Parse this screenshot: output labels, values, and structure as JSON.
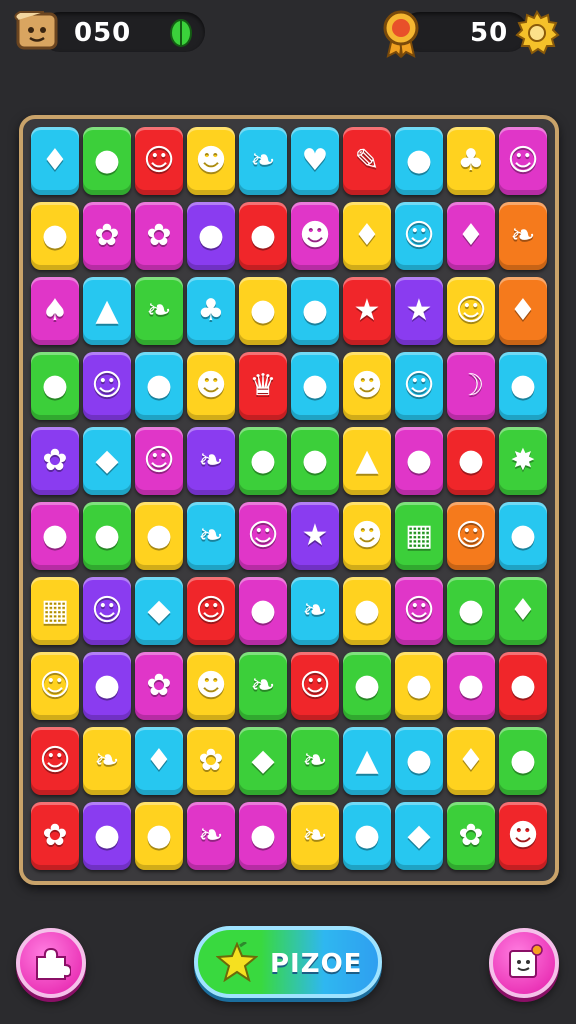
{
  "hud": {
    "left_value": "050",
    "right_value": "50",
    "left_icon": "scroll-face-icon",
    "left_gem_icon": "green-leaf-gem-icon",
    "right_medal_icon": "orange-medal-icon",
    "right_settings_icon": "gear-icon"
  },
  "buttons": {
    "left_icon": "puzzle-piece-icon",
    "main_label": "PIZOE",
    "main_icon": "star-fruit-icon",
    "right_icon": "smiling-cube-icon"
  },
  "colors": {
    "background": "#2b2b2e",
    "frame": "#c9a36a",
    "main_button_green": "#39d93f",
    "main_button_blue": "#2fb7f0",
    "round_button_pink": "#e31aa8"
  },
  "board": {
    "rows": [
      [
        {
          "color": "#27c7f0",
          "icon": "yellow-lemon-icon",
          "glyph": "♦"
        },
        {
          "color": "#3ccf3a",
          "icon": "yellow-lemon-icon",
          "glyph": "●"
        },
        {
          "color": "#f0262a",
          "icon": "white-ghost-face-icon",
          "glyph": "☺"
        },
        {
          "color": "#ffd21f",
          "icon": "yellow-face-icon",
          "glyph": "☻"
        },
        {
          "color": "#27c7f0",
          "icon": "orange-leaf-icon",
          "glyph": "❧"
        },
        {
          "color": "#27c7f0",
          "icon": "red-heart-icon",
          "glyph": "♥"
        },
        {
          "color": "#f0262a",
          "icon": "pink-candy-icon",
          "glyph": "✎"
        },
        {
          "color": "#27c7f0",
          "icon": "red-apple-icon",
          "glyph": "●"
        },
        {
          "color": "#ffd21f",
          "icon": "green-broccoli-icon",
          "glyph": "♣"
        },
        {
          "color": "#e036c8",
          "icon": "yellow-face-icon",
          "glyph": "☺"
        }
      ],
      [
        {
          "color": "#ffd21f",
          "icon": "green-apple-icon",
          "glyph": "●"
        },
        {
          "color": "#e036c8",
          "icon": "orange-flower-icon",
          "glyph": "✿"
        },
        {
          "color": "#e036c8",
          "icon": "green-flower-icon",
          "glyph": "✿"
        },
        {
          "color": "#8a3cf0",
          "icon": "blue-apple-icon",
          "glyph": "●"
        },
        {
          "color": "#f0262a",
          "icon": "yellow-ball-icon",
          "glyph": "●"
        },
        {
          "color": "#e036c8",
          "icon": "red-tomato-face-icon",
          "glyph": "☻"
        },
        {
          "color": "#ffd21f",
          "icon": "blue-drop-icon",
          "glyph": "♦"
        },
        {
          "color": "#27c7f0",
          "icon": "purple-ball-face-icon",
          "glyph": "☺"
        },
        {
          "color": "#e036c8",
          "icon": "purple-eggplant-icon",
          "glyph": "♦"
        },
        {
          "color": "#f57a1c",
          "icon": "red-leaf-icon",
          "glyph": "❧"
        }
      ],
      [
        {
          "color": "#e036c8",
          "icon": "orange-mushroom-icon",
          "glyph": "♠"
        },
        {
          "color": "#27c7f0",
          "icon": "blue-bell-icon",
          "glyph": "▲"
        },
        {
          "color": "#3ccf3a",
          "icon": "green-leaf-icon",
          "glyph": "❧"
        },
        {
          "color": "#27c7f0",
          "icon": "red-cherry-icon",
          "glyph": "♣"
        },
        {
          "color": "#ffd21f",
          "icon": "purple-plum-icon",
          "glyph": "●"
        },
        {
          "color": "#27c7f0",
          "icon": "red-berry-icon",
          "glyph": "●"
        },
        {
          "color": "#f0262a",
          "icon": "yellow-star-icon",
          "glyph": "★"
        },
        {
          "color": "#8a3cf0",
          "icon": "yellow-star-icon",
          "glyph": "★"
        },
        {
          "color": "#ffd21f",
          "icon": "cat-face-icon",
          "glyph": "☺"
        },
        {
          "color": "#f57a1c",
          "icon": "blue-drop-icon",
          "glyph": "♦"
        }
      ],
      [
        {
          "color": "#3ccf3a",
          "icon": "green-lime-icon",
          "glyph": "●"
        },
        {
          "color": "#8a3cf0",
          "icon": "yellow-pear-face-icon",
          "glyph": "☺"
        },
        {
          "color": "#27c7f0",
          "icon": "purple-plum-icon",
          "glyph": "●"
        },
        {
          "color": "#ffd21f",
          "icon": "red-tomato-face-icon",
          "glyph": "☻"
        },
        {
          "color": "#f0262a",
          "icon": "blue-crown-icon",
          "glyph": "♛"
        },
        {
          "color": "#27c7f0",
          "icon": "purple-berry-icon",
          "glyph": "●"
        },
        {
          "color": "#ffd21f",
          "icon": "red-apple-face-icon",
          "glyph": "☻"
        },
        {
          "color": "#27c7f0",
          "icon": "purple-ghost-icon",
          "glyph": "☺"
        },
        {
          "color": "#e036c8",
          "icon": "white-banana-icon",
          "glyph": "☽"
        },
        {
          "color": "#27c7f0",
          "icon": "purple-berry-icon",
          "glyph": "●"
        }
      ],
      [
        {
          "color": "#8a3cf0",
          "icon": "orange-leaf-icon",
          "glyph": "✿"
        },
        {
          "color": "#27c7f0",
          "icon": "orange-bar-icon",
          "glyph": "◆"
        },
        {
          "color": "#e036c8",
          "icon": "yellow-face-icon",
          "glyph": "☺"
        },
        {
          "color": "#8a3cf0",
          "icon": "yellow-leaf-icon",
          "glyph": "❧"
        },
        {
          "color": "#3ccf3a",
          "icon": "tan-potato-icon",
          "glyph": "●"
        },
        {
          "color": "#3ccf3a",
          "icon": "red-berry-icon",
          "glyph": "●"
        },
        {
          "color": "#ffd21f",
          "icon": "green-bell-icon",
          "glyph": "▲"
        },
        {
          "color": "#e036c8",
          "icon": "red-apple-icon",
          "glyph": "●"
        },
        {
          "color": "#f0262a",
          "icon": "blue-ball-icon",
          "glyph": "●"
        },
        {
          "color": "#3ccf3a",
          "icon": "yellow-star-icon",
          "glyph": "✸"
        }
      ],
      [
        {
          "color": "#e036c8",
          "icon": "purple-plum-icon",
          "glyph": "●"
        },
        {
          "color": "#3ccf3a",
          "icon": "orange-pumpkin-icon",
          "glyph": "●"
        },
        {
          "color": "#ffd21f",
          "icon": "orange-onion-icon",
          "glyph": "●"
        },
        {
          "color": "#27c7f0",
          "icon": "green-leaf-icon",
          "glyph": "❧"
        },
        {
          "color": "#e036c8",
          "icon": "white-ghost-icon",
          "glyph": "☺"
        },
        {
          "color": "#8a3cf0",
          "icon": "yellow-star-icon",
          "glyph": "★"
        },
        {
          "color": "#ffd21f",
          "icon": "blue-ball-face-icon",
          "glyph": "☻"
        },
        {
          "color": "#3ccf3a",
          "icon": "orange-waffle-icon",
          "glyph": "▦"
        },
        {
          "color": "#f57a1c",
          "icon": "cream-face-icon",
          "glyph": "☺"
        },
        {
          "color": "#27c7f0",
          "icon": "purple-ball-icon",
          "glyph": "●"
        }
      ],
      [
        {
          "color": "#ffd21f",
          "icon": "purple-grape-icon",
          "glyph": "▦"
        },
        {
          "color": "#8a3cf0",
          "icon": "yellow-pear-face-icon",
          "glyph": "☺"
        },
        {
          "color": "#27c7f0",
          "icon": "tan-bread-icon",
          "glyph": "◆"
        },
        {
          "color": "#f0262a",
          "icon": "white-ghost-face-icon",
          "glyph": "☺"
        },
        {
          "color": "#e036c8",
          "icon": "blue-egg-icon",
          "glyph": "●"
        },
        {
          "color": "#27c7f0",
          "icon": "orange-leaf-icon",
          "glyph": "❧"
        },
        {
          "color": "#ffd21f",
          "icon": "purple-berry-icon",
          "glyph": "●"
        },
        {
          "color": "#e036c8",
          "icon": "white-ghost-face-icon",
          "glyph": "☺"
        },
        {
          "color": "#3ccf3a",
          "icon": "red-apple-icon",
          "glyph": "●"
        },
        {
          "color": "#3ccf3a",
          "icon": "yellow-mango-icon",
          "glyph": "♦"
        }
      ],
      [
        {
          "color": "#ffd21f",
          "icon": "blue-drop-face-icon",
          "glyph": "☺"
        },
        {
          "color": "#8a3cf0",
          "icon": "red-apple-icon",
          "glyph": "●"
        },
        {
          "color": "#e036c8",
          "icon": "orange-flower-icon",
          "glyph": "✿"
        },
        {
          "color": "#ffd21f",
          "icon": "orange-fruit-face-icon",
          "glyph": "☻"
        },
        {
          "color": "#3ccf3a",
          "icon": "tan-leaf-icon",
          "glyph": "❧"
        },
        {
          "color": "#f0262a",
          "icon": "cream-face-icon",
          "glyph": "☺"
        },
        {
          "color": "#3ccf3a",
          "icon": "green-lime-icon",
          "glyph": "●"
        },
        {
          "color": "#ffd21f",
          "icon": "red-apple-icon",
          "glyph": "●"
        },
        {
          "color": "#e036c8",
          "icon": "green-melon-icon",
          "glyph": "●"
        },
        {
          "color": "#f0262a",
          "icon": "red-apple-icon",
          "glyph": "●"
        }
      ],
      [
        {
          "color": "#f0262a",
          "icon": "yellow-ghost-face-icon",
          "glyph": "☺"
        },
        {
          "color": "#ffd21f",
          "icon": "green-leaf-icon",
          "glyph": "❧"
        },
        {
          "color": "#27c7f0",
          "icon": "yellow-lemon-icon",
          "glyph": "♦"
        },
        {
          "color": "#ffd21f",
          "icon": "yellow-cheese-icon",
          "glyph": "✿"
        },
        {
          "color": "#3ccf3a",
          "icon": "orange-carrot-icon",
          "glyph": "◆"
        },
        {
          "color": "#3ccf3a",
          "icon": "orange-leaf-icon",
          "glyph": "❧"
        },
        {
          "color": "#27c7f0",
          "icon": "pink-cupcake-icon",
          "glyph": "▲"
        },
        {
          "color": "#27c7f0",
          "icon": "pink-apple-icon",
          "glyph": "●"
        },
        {
          "color": "#ffd21f",
          "icon": "blue-drop-icon",
          "glyph": "♦"
        },
        {
          "color": "#3ccf3a",
          "icon": "purple-berry-icon",
          "glyph": "●"
        }
      ],
      [
        {
          "color": "#f0262a",
          "icon": "blue-flower-face-icon",
          "glyph": "✿"
        },
        {
          "color": "#8a3cf0",
          "icon": "blue-berry-icon",
          "glyph": "●"
        },
        {
          "color": "#ffd21f",
          "icon": "purple-plum-icon",
          "glyph": "●"
        },
        {
          "color": "#e036c8",
          "icon": "green-leaf-icon",
          "glyph": "❧"
        },
        {
          "color": "#e036c8",
          "icon": "blue-egg-icon",
          "glyph": "●"
        },
        {
          "color": "#ffd21f",
          "icon": "orange-leaf-icon",
          "glyph": "❧"
        },
        {
          "color": "#27c7f0",
          "icon": "yellow-ball-icon",
          "glyph": "●"
        },
        {
          "color": "#27c7f0",
          "icon": "white-cake-icon",
          "glyph": "◆"
        },
        {
          "color": "#3ccf3a",
          "icon": "orange-flower-icon",
          "glyph": "✿"
        },
        {
          "color": "#f0262a",
          "icon": "pink-blob-face-icon",
          "glyph": "☻"
        }
      ]
    ]
  }
}
